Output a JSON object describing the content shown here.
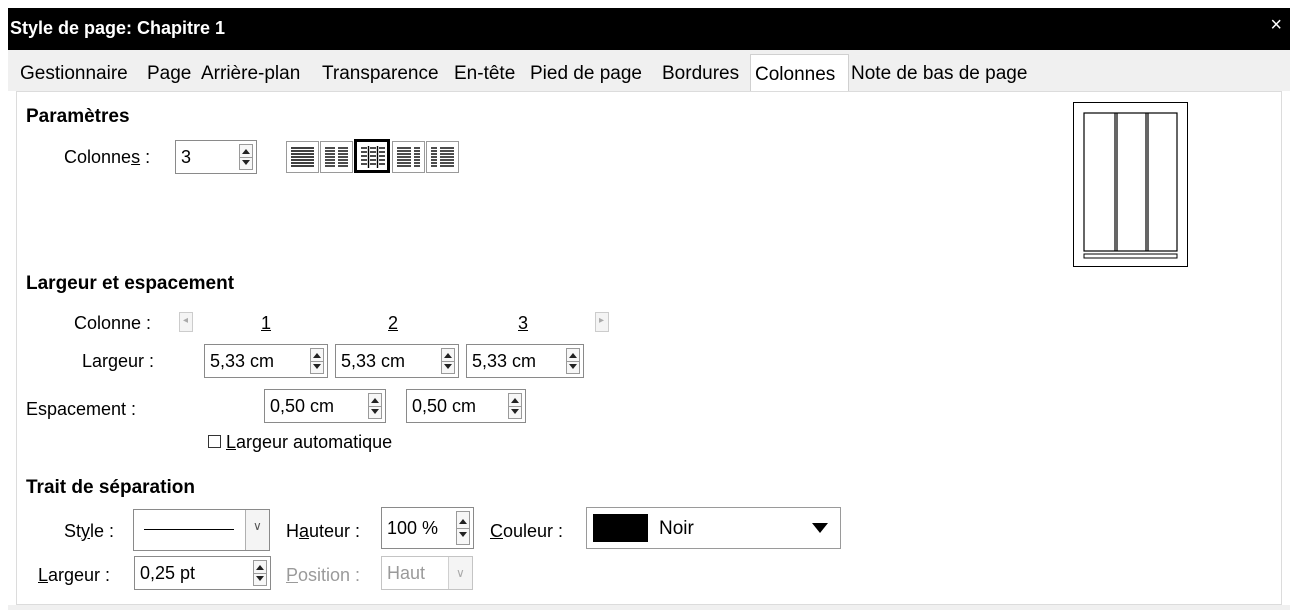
{
  "window": {
    "title": "Style de page: Chapitre 1",
    "close_glyph": "×"
  },
  "tabs": [
    {
      "label": "Gestionnaire"
    },
    {
      "label": "Page"
    },
    {
      "label": "Arrière-plan"
    },
    {
      "label": "Transparence"
    },
    {
      "label": "En-tête"
    },
    {
      "label": "Pied de page"
    },
    {
      "label": "Bordures"
    },
    {
      "label": "Colonnes"
    },
    {
      "label": "Note de bas de page"
    }
  ],
  "active_tab": "Colonnes",
  "parametres": {
    "title": "Paramètres",
    "colonnes_label_pre": "Colonne",
    "colonnes_label_key": "s",
    "colonnes_label_post": " :",
    "colonnes_value": "3",
    "layouts": [
      "layout-1-column-icon",
      "layout-2-columns-icon",
      "layout-3-columns-icon",
      "layout-2-columns-left-wide-icon",
      "layout-2-columns-right-wide-icon"
    ],
    "selected_layout": 2
  },
  "largeur": {
    "title": "Largeur et espacement",
    "colonne_label": "Colonne :",
    "column_numbers": [
      "1",
      "2",
      "3"
    ],
    "largeur_label_pre": "Lar",
    "largeur_label_key": "g",
    "largeur_label_post": "eur :",
    "widths": [
      "5,33 cm",
      "5,33 cm",
      "5,33 cm"
    ],
    "espacement_label": "Espacement :",
    "spacings": [
      "0,50 cm",
      "0,50 cm"
    ],
    "auto_key": "L",
    "auto_rest": "argeur automatique",
    "auto_checked": false
  },
  "trait": {
    "title": "Trait de séparation",
    "style_label_pre": "St",
    "style_label_key": "y",
    "style_label_post": "le :",
    "hauteur_label_pre": "H",
    "hauteur_label_key": "a",
    "hauteur_label_post": "uteur :",
    "hauteur_value": "100 %",
    "couleur_label_key": "C",
    "couleur_label_post": "ouleur :",
    "couleur_value": "Noir",
    "couleur_hex": "#000000",
    "largeur_label_key": "L",
    "largeur_label_post": "argeur :",
    "largeur_value": "0,25 pt",
    "position_label_key": "P",
    "position_label_post": "osition :",
    "position_value": "Haut"
  }
}
